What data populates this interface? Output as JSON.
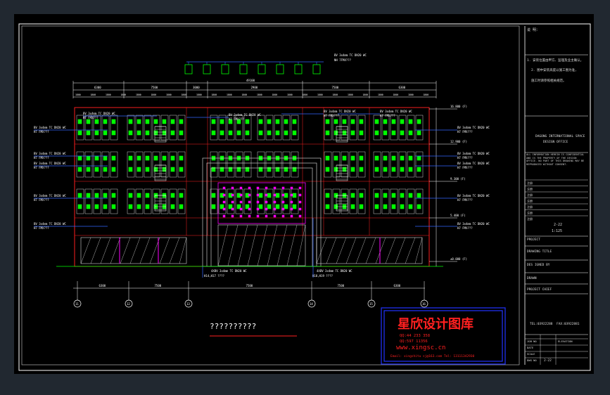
{
  "drawing": {
    "caption": "??????????",
    "overall_width": "49100",
    "top_segments": [
      "6300",
      "7500",
      "3000",
      "2900",
      "7500",
      "6300"
    ],
    "bay_dims": [
      "1800",
      "1800",
      "1800",
      "1800",
      "1800",
      "1800",
      "1800",
      "1800"
    ],
    "bottom_dims": [
      "6300",
      "7500",
      "7500",
      "7500",
      "6300"
    ],
    "axis_labels": [
      "11",
      "12",
      "13",
      "14",
      "15",
      "16"
    ],
    "elevations": [
      "16.800 (F)",
      "12.900 (F)",
      "9.300 (F)",
      "5.400 (F)",
      "±0.000 (F)"
    ],
    "cable_notes": [
      "BV 3x4mm TC DN20 WC",
      "NH 7FMX???",
      "BV 3x4mm TC DN20 WC",
      "H7 FMX???",
      "BV 3x4mm TC DN20 WC",
      "H7 FMX???",
      "BV 3x4mm TC DN20 WC",
      "H7 FMX???",
      "BV 3x4mm TC DN20 WC",
      "H7 FMX???",
      "BV 3x4mm TC DN20 WC",
      "H7 FMX???",
      "BV 3x4mm TC DN20 WC",
      "H7 FMX???",
      "BV 3x4mm TC DN20 WC",
      "H7 FMX???",
      "BV 3x4mm TC DN20 WC",
      "H7 FMX???"
    ],
    "bottom_notes": [
      "4XBV 3x4mm TC DN20 WC",
      "H14,H17 ????",
      "4XBV 3x4mm TC DN20 WC",
      "H18,H19 ????"
    ]
  },
  "title_block": {
    "notes_header": "说 明：",
    "notes": [
      "1. 安装位置由甲方、监理及业主确认。",
      "2. 图中安装高度以施工图为准，",
      "施工时请参照相关规范。"
    ],
    "company": [
      "DAGONG INTERNATIONAL SPACE",
      "DESIGN OFFICE"
    ],
    "disclaimer": "ALL INFORMATION HEREIN IS CONFIDENTIAL AND IS THE PROPERTY OF THE DESIGN OFFICE. NO PART OF THIS DRAWING MAY BE REPRODUCED WITHOUT CONSENT.",
    "rows": [
      "注册",
      "注册",
      "注册",
      "注册",
      "注册",
      "注册",
      "注册"
    ],
    "date": "2-22",
    "scale": "1:125",
    "project_label": "PROJECT",
    "drawing_title_label": "DRAWING TITLE",
    "designed_label": "DES IGNED BY",
    "drawn_label": "DRAWN",
    "project_chief_label": "PROJECT CHIEF",
    "tel": "TEL:03922288",
    "fax": "FAX:03922881",
    "job_no_label": "JOB NO",
    "date_label": "DATE",
    "scale_label": "SCALE",
    "dwg_label": "DWG NO",
    "drawing_no": "2-22",
    "sheet": "ELEVATION"
  },
  "stamp": {
    "title": "星欣设计图库",
    "qq1": "QQ:44 233 358",
    "qq2": "QQ:597 11356",
    "url": "www.xingsc.cn",
    "email": "Email: xingshitu sj@163.com  Tel: 13111342930"
  }
}
